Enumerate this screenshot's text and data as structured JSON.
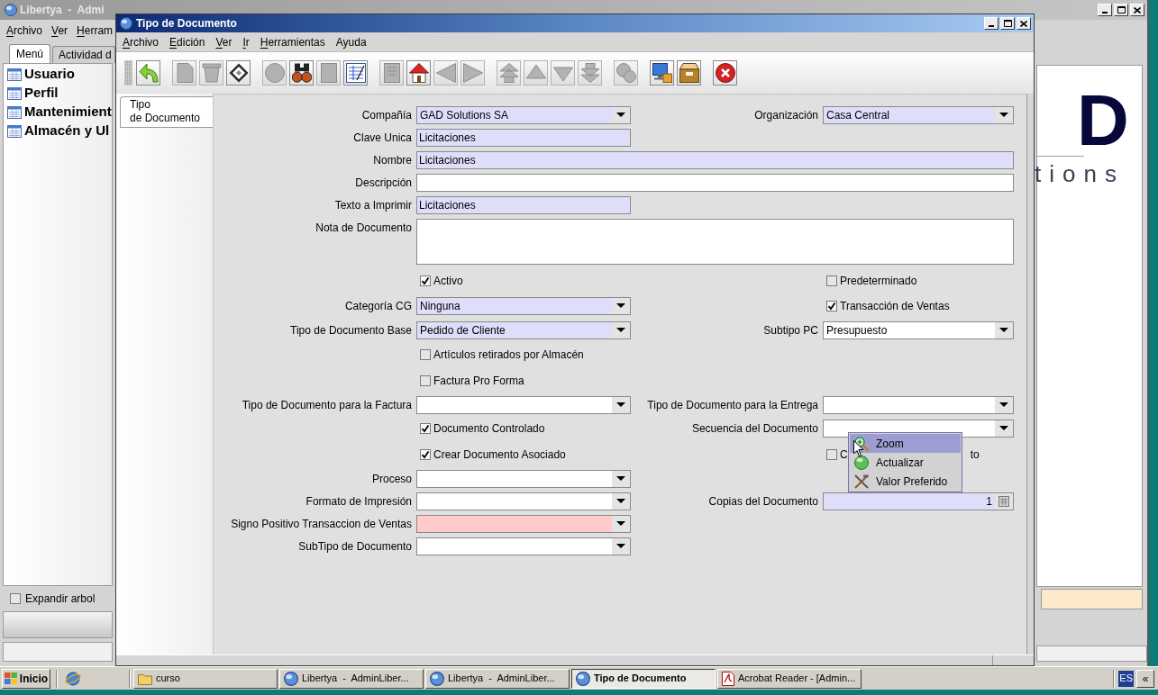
{
  "main_window": {
    "title": "Libertya  -  Admi",
    "menu": [
      {
        "label": "Archivo",
        "mnemonic": true
      },
      {
        "label": "Ver",
        "mnemonic": true
      },
      {
        "label": "Herram",
        "mnemonic": true
      }
    ],
    "tabs": [
      {
        "label": "Menú",
        "selected": true
      },
      {
        "label": "Actividad d",
        "selected": false
      }
    ],
    "tree": [
      {
        "label": "Usuario"
      },
      {
        "label": "Perfil"
      },
      {
        "label": "Mantenimient"
      },
      {
        "label": "Almacén y Ul"
      }
    ],
    "expand_tree": {
      "label": "Expandir arbol",
      "checked": false
    },
    "logo": {
      "mark": "D",
      "tagline": "tions"
    }
  },
  "document_window": {
    "title": "Tipo de Documento",
    "menu": [
      {
        "label": "Archivo",
        "mnemonic": true
      },
      {
        "label": "Edición",
        "mnemonic": true
      },
      {
        "label": "Ver",
        "mnemonic": true
      },
      {
        "label": "Ir",
        "mnemonic": true
      },
      {
        "label": "Herramientas",
        "mnemonic": true
      },
      {
        "label": "Ayuda",
        "mnemonic": false
      }
    ],
    "toolbar": [
      [
        {
          "kind": "undo",
          "disabled": false
        }
      ],
      [
        {
          "kind": "new",
          "disabled": true
        },
        {
          "kind": "delete",
          "disabled": true
        },
        {
          "kind": "save",
          "disabled": false
        }
      ],
      [
        {
          "kind": "refresh",
          "disabled": true
        },
        {
          "kind": "find",
          "disabled": false
        },
        {
          "kind": "attachment",
          "disabled": true
        },
        {
          "kind": "grid",
          "disabled": false
        }
      ],
      [
        {
          "kind": "history",
          "disabled": true
        },
        {
          "kind": "home",
          "disabled": false
        },
        {
          "kind": "previous",
          "disabled": true
        },
        {
          "kind": "next",
          "disabled": true
        }
      ],
      [
        {
          "kind": "first",
          "disabled": true
        },
        {
          "kind": "up",
          "disabled": true
        },
        {
          "kind": "down",
          "disabled": true
        },
        {
          "kind": "last",
          "disabled": true
        }
      ],
      [
        {
          "kind": "report",
          "disabled": true
        }
      ],
      [
        {
          "kind": "archive",
          "disabled": false
        },
        {
          "kind": "product",
          "disabled": false
        }
      ],
      [
        {
          "kind": "exit",
          "disabled": false
        }
      ]
    ],
    "side_tabs": [
      {
        "label": "Tipo\nde Documento",
        "selected": true
      }
    ],
    "form": {
      "rows": [
        {
          "left": {
            "kind": "combo",
            "label": "Compañía",
            "value": "GAD Solutions SA",
            "mandatory": true,
            "missing": false
          },
          "right": {
            "kind": "combo",
            "label": "Organización",
            "value": "Casa Central",
            "mandatory": true,
            "missing": false
          }
        },
        {
          "left": {
            "kind": "text",
            "label": "Clave Unica",
            "value": "Licitaciones",
            "mandatory": true,
            "missing": false
          }
        },
        {
          "full": {
            "kind": "text",
            "label": "Nombre",
            "value": "Licitaciones",
            "mandatory": true,
            "missing": false
          }
        },
        {
          "full": {
            "kind": "text",
            "label": "Descripción",
            "mandatory": false,
            "missing": false
          }
        },
        {
          "left": {
            "kind": "text",
            "label": "Texto a Imprimir",
            "value": "Licitaciones",
            "mandatory": true,
            "missing": false
          }
        },
        {
          "full": {
            "kind": "textarea",
            "label": "Nota de Documento",
            "mandatory": false,
            "missing": false
          }
        },
        {
          "left": {
            "kind": "checkbox",
            "label": "Activo",
            "checked": true
          },
          "right": {
            "kind": "checkbox",
            "label": "Predeterminado",
            "checked": false
          }
        },
        {
          "left": {
            "kind": "combo",
            "label": "Categoría CG",
            "value": "Ninguna",
            "mandatory": true,
            "missing": false
          },
          "right": {
            "kind": "checkbox",
            "label": "Transacción de Ventas",
            "checked": true
          }
        },
        {
          "left": {
            "kind": "combo",
            "label": "Tipo de Documento Base",
            "value": "Pedido de Cliente",
            "mandatory": true,
            "missing": false
          },
          "right": {
            "kind": "combo",
            "label": "Subtipo PC",
            "value": "Presupuesto",
            "mandatory": false,
            "missing": false
          }
        },
        {
          "left": {
            "kind": "checkbox",
            "label": "Artículos retirados por Almacén",
            "checked": false
          }
        },
        {
          "left": {
            "kind": "checkbox",
            "label": "Factura Pro Forma",
            "checked": false
          }
        },
        {
          "left": {
            "kind": "combo",
            "label": "Tipo de Documento para la Factura",
            "mandatory": false,
            "missing": false
          },
          "right": {
            "kind": "combo",
            "label": "Tipo de Documento para la Entrega",
            "mandatory": false,
            "missing": false
          }
        },
        {
          "left": {
            "kind": "checkbox",
            "label": "Documento Controlado",
            "checked": true
          },
          "right": {
            "kind": "combo",
            "label": "Secuencia del Documento",
            "mandatory": false,
            "missing": false
          }
        },
        {
          "left": {
            "kind": "checkbox",
            "label": "Crear Documento Asociado",
            "checked": true
          },
          "right": {
            "kind": "checkbox",
            "label": "C",
            "label_tail": "to",
            "checked": false
          }
        },
        {
          "left": {
            "kind": "combo",
            "label": "Proceso",
            "mandatory": false,
            "missing": false
          }
        },
        {
          "left": {
            "kind": "combo",
            "label": "Formato de Impresión",
            "mandatory": false,
            "missing": false
          },
          "right": {
            "kind": "number",
            "label": "Copias del Documento",
            "value": "1",
            "mandatory": true,
            "missing": false
          }
        },
        {
          "left": {
            "kind": "combo",
            "label": "Signo Positivo Transaccion de Ventas",
            "missing": true
          }
        },
        {
          "left": {
            "kind": "combo",
            "label": "SubTipo de Documento",
            "mandatory": false,
            "missing": false
          }
        }
      ]
    }
  },
  "context_menu": [
    {
      "kind": "zoom",
      "label": "Zoom",
      "selected": true
    },
    {
      "kind": "refresh",
      "label": "Actualizar",
      "selected": false
    },
    {
      "kind": "preference",
      "label": "Valor Preferido",
      "selected": false
    }
  ],
  "taskbar": {
    "start": "Inicio",
    "tasks": [
      {
        "kind": "folder",
        "label": "curso",
        "selected": false
      },
      {
        "kind": "app",
        "label": "Libertya  -  AdminLiber...",
        "selected": false
      },
      {
        "kind": "app",
        "label": "Libertya  -  AdminLiber...",
        "selected": false
      },
      {
        "kind": "app",
        "label": "Tipo de Documento",
        "selected": true
      },
      {
        "kind": "pdf",
        "label": "Acrobat Reader - [Admin...",
        "selected": false
      }
    ],
    "language": "ES",
    "tray_toggle": "«"
  }
}
